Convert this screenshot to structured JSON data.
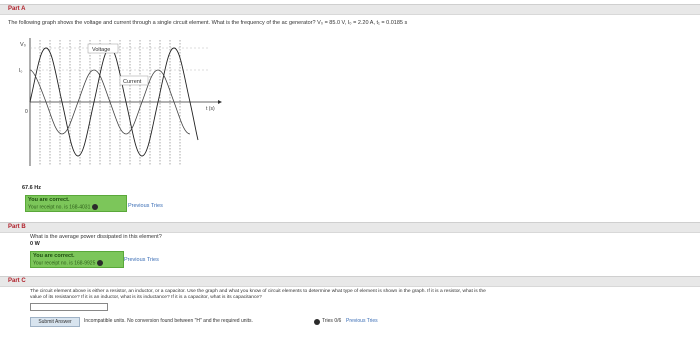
{
  "partA": {
    "label": "Part A",
    "question": "The following graph shows the voltage and current through a single circuit element. What is the frequency of the ac generator? V₀ = 85.0 V, I₀ = 2.20 A, t₁ = 0.0185 s",
    "graph": {
      "y_axis_label": "V₀",
      "i_label": "I₀",
      "voltage_label": "Voltage",
      "current_label": "Current",
      "t_label": "t (s)",
      "origin_label": "0"
    },
    "answer": "67.6 Hz",
    "feedback_title": "You are correct.",
    "feedback_receipt": "Your receipt no. is 168-4031",
    "previous_tries": "Previous Tries"
  },
  "partB": {
    "label": "Part B",
    "question": "What is the average power dissipated in this element?",
    "answer": "0 W",
    "feedback_title": "You are correct.",
    "feedback_receipt": "Your receipt no. is 168-9925",
    "previous_tries": "Previous Tries"
  },
  "partC": {
    "label": "Part C",
    "question_line1": "The circuit element above is either a resistor, an inductor, or a capacitor. Use the graph and what you know of circuit elements to determine what type of element is shown in the graph. If it is a resistor, what is the",
    "question_line2": "value of its resistance? If it is an inductor, what is its inductance? If it is a capacitor, what is its capacitance?",
    "input_value": "",
    "submit_label": "Submit Answer",
    "feedback": "Incompatible units. No conversion found between \"H\" and the required units.",
    "tries": "Tries 0/6",
    "previous_tries": "Previous Tries"
  },
  "colors": {
    "part_label": "#b0202a",
    "correct_bg": "#7cc65a",
    "link": "#3a6db5"
  }
}
